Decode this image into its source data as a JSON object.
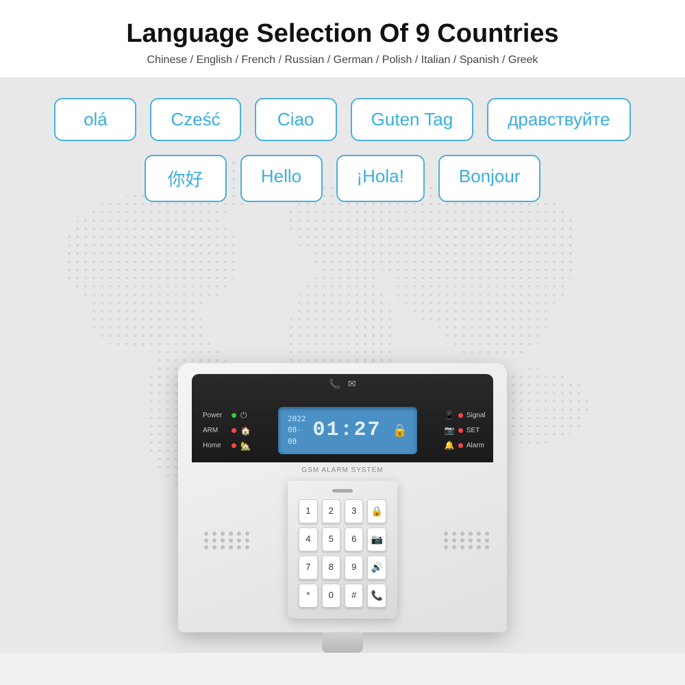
{
  "header": {
    "title": "Language Selection Of 9 Countries",
    "subtitle": "Chinese / English / French / Russian / German / Polish / Italian / Spanish / Greek"
  },
  "greetings": {
    "row1": [
      {
        "text": "olá",
        "id": "portuguese"
      },
      {
        "text": "Cześć",
        "id": "polish"
      },
      {
        "text": "Ciao",
        "id": "italian"
      },
      {
        "text": "Guten Tag",
        "id": "german"
      },
      {
        "text": "дравствуйте",
        "id": "russian"
      }
    ],
    "row2": [
      {
        "text": "你好",
        "id": "chinese"
      },
      {
        "text": "Hello",
        "id": "english"
      },
      {
        "text": "¡Hola!",
        "id": "spanish"
      },
      {
        "text": "Bonjour",
        "id": "french"
      }
    ]
  },
  "device": {
    "label": "GSM ALARM SYSTEM",
    "lcd": {
      "date": "2022\n08-08",
      "time": "01:27"
    },
    "status_left": [
      {
        "label": "Power",
        "dot": "green",
        "icon": "⏻"
      },
      {
        "label": "ARM",
        "dot": "red",
        "icon": "🏠"
      },
      {
        "label": "Home",
        "dot": "red",
        "icon": "🏡"
      }
    ],
    "status_right": [
      {
        "icon": "📱",
        "dot": "red",
        "label": "Signal"
      },
      {
        "icon": "📷",
        "dot": "red",
        "label": "SET"
      },
      {
        "icon": "🔔",
        "dot": "red",
        "label": "Alarm"
      }
    ],
    "keypad": {
      "keys": [
        "1",
        "2",
        "3",
        "🔒",
        "4",
        "5",
        "6",
        "📷",
        "7",
        "8",
        "9",
        "🔊",
        "*",
        "0",
        "#",
        "📞"
      ]
    }
  },
  "colors": {
    "accent_blue": "#3aaedc",
    "bubble_border": "#4ab0d9",
    "lcd_bg": "#4a90c4",
    "green_dot": "#2ecc40",
    "red_dot": "#ff4444"
  }
}
